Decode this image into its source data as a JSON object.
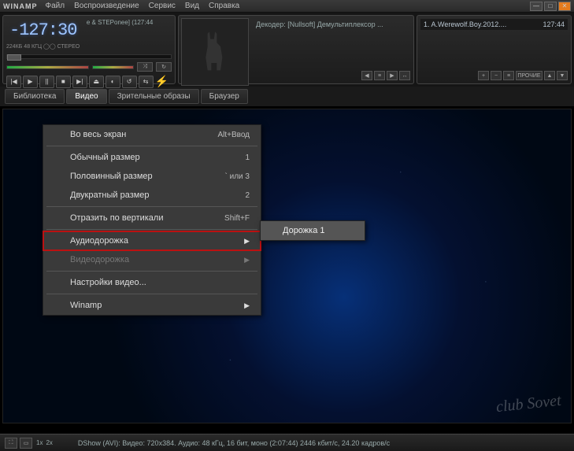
{
  "title": "WINAMP",
  "menubar": [
    "Файл",
    "Воспроизведение",
    "Сервис",
    "Вид",
    "Справка"
  ],
  "player": {
    "time": "-127:30",
    "song": "e & STEPonee] (127:44",
    "meta": "224КБ   48 КГЦ  ◯◯ СТЕРЕО",
    "decoder_label": "Декодер:",
    "decoder_value": "[Nullsoft] Демультиплексор ..."
  },
  "playlist": {
    "item_title": "1. A.Werewolf.Boy.2012....",
    "item_time": "127:44"
  },
  "tabs": [
    "Библиотека",
    "Видео",
    "Зрительные образы",
    "Браузер"
  ],
  "active_tab": 1,
  "context_menu": [
    {
      "label": "Во весь экран",
      "shortcut": "Alt+Ввод",
      "type": "item"
    },
    {
      "type": "sep"
    },
    {
      "label": "Обычный размер",
      "shortcut": "1",
      "type": "item"
    },
    {
      "label": "Половинный размер",
      "shortcut": "` или 3",
      "type": "item"
    },
    {
      "label": "Двукратный размер",
      "shortcut": "2",
      "type": "item"
    },
    {
      "type": "sep"
    },
    {
      "label": "Отразить по вертикали",
      "shortcut": "Shift+F",
      "type": "item"
    },
    {
      "type": "sep"
    },
    {
      "label": "Аудиодорожка",
      "type": "sub",
      "highlighted": true
    },
    {
      "label": "Видеодорожка",
      "type": "sub",
      "disabled": true
    },
    {
      "type": "sep"
    },
    {
      "label": "Настройки видео...",
      "type": "item"
    },
    {
      "type": "sep"
    },
    {
      "label": "Winamp",
      "type": "sub"
    }
  ],
  "submenu_item": "Дорожка 1",
  "status": {
    "zoom": {
      "x1": "1x",
      "x2": "2x"
    },
    "text": "DShow (AVI): Видео: 720x384. Аудио: 48 кГц, 16 бит, моно (2:07:44) 2446 кбит/с, 24.20 кадров/с"
  },
  "watermark": "club Sovet",
  "tiny_label": "ПРОЧИЕ"
}
